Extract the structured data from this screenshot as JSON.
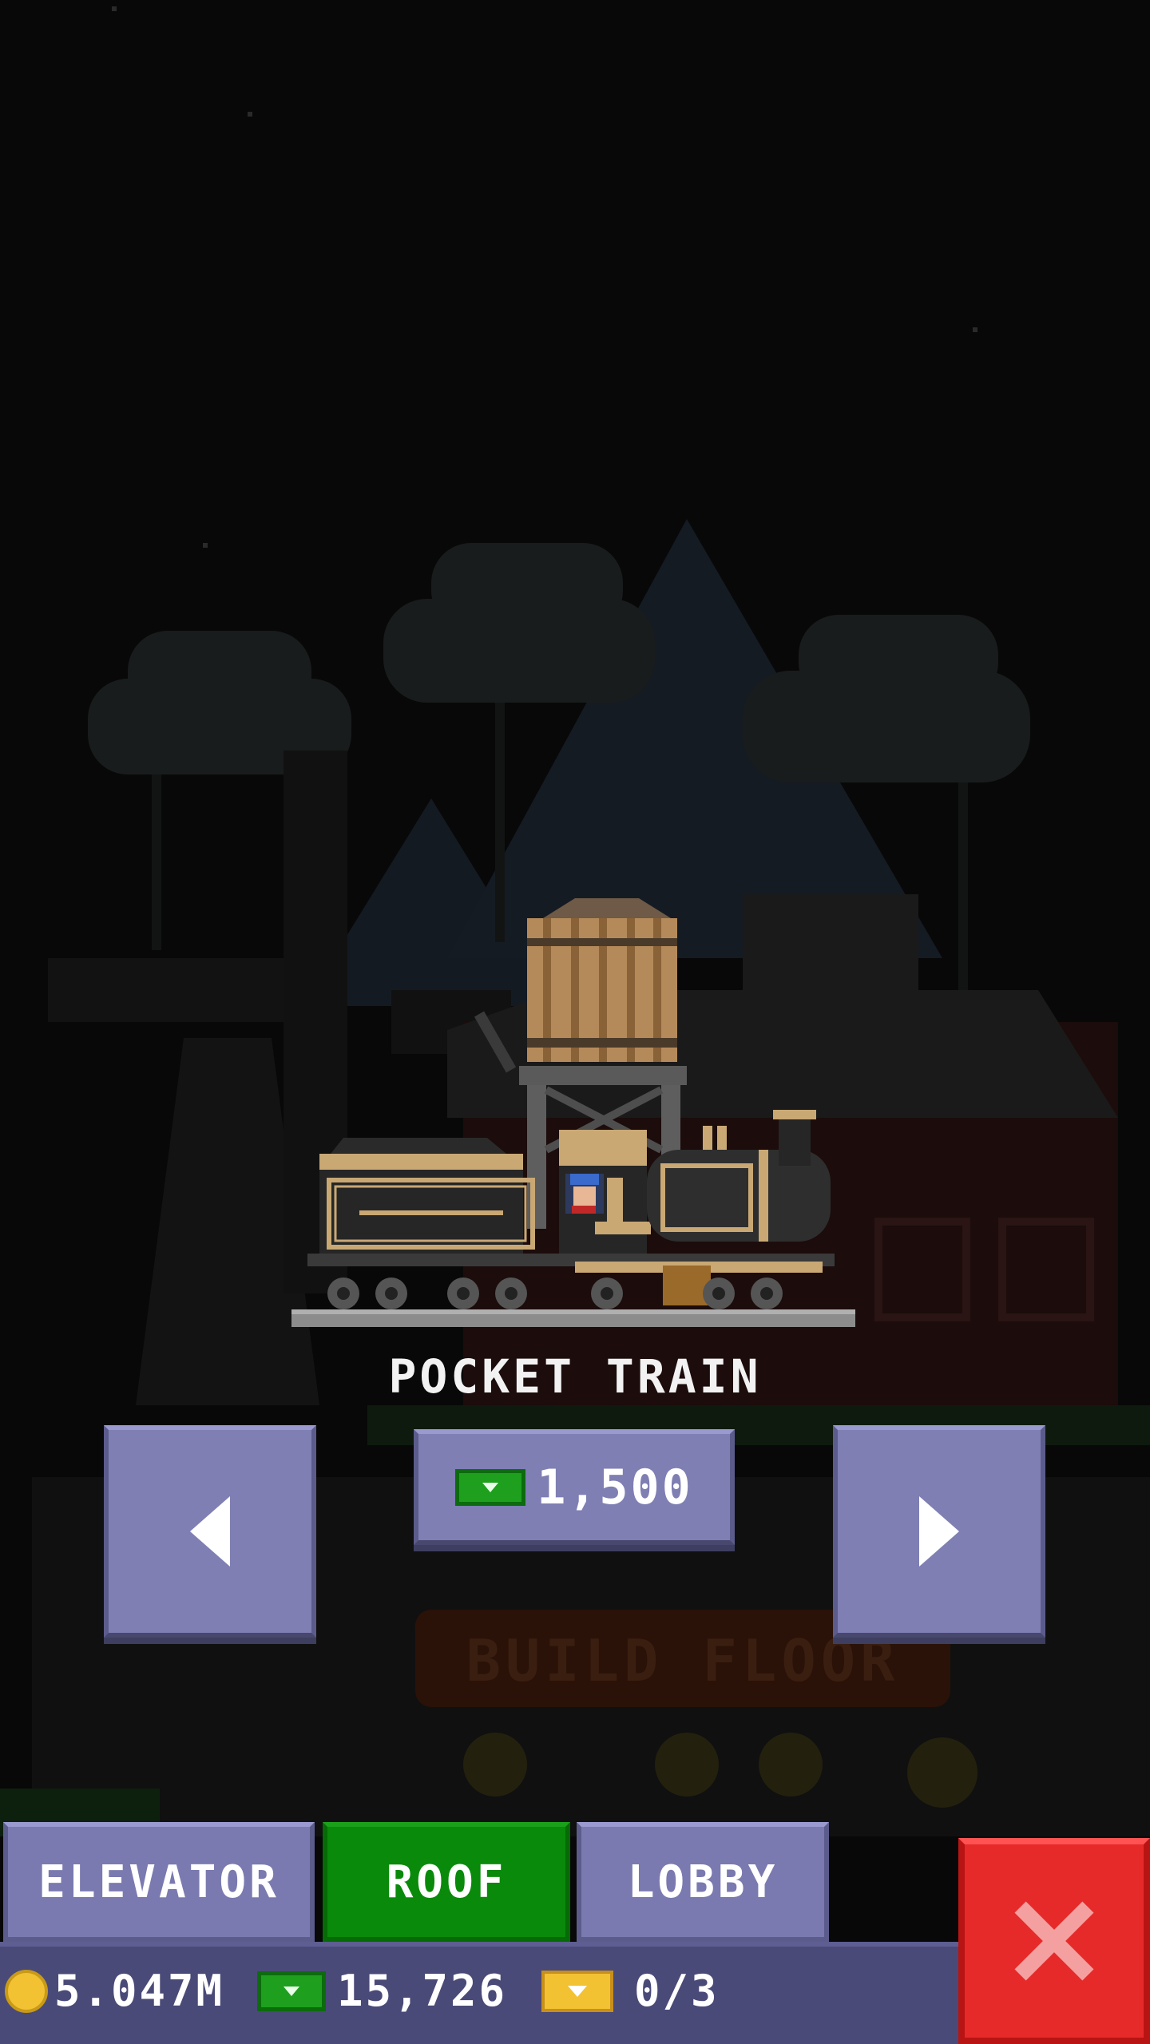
{
  "item": {
    "name": "POCKET TRAIN",
    "price": "1,500"
  },
  "background_sign": "BUILD FLOOR",
  "tabs": {
    "elevator": "ELEVATOR",
    "roof": "ROOF",
    "lobby": "LOBBY",
    "active": "roof"
  },
  "status": {
    "coins": "5.047M",
    "bux": "15,726",
    "tickets": "0/3"
  },
  "icons": {
    "prev": "arrow-left-icon",
    "next": "arrow-right-icon",
    "price": "tower-bux-icon",
    "coins": "coin-icon",
    "bux": "tower-bux-icon",
    "tickets": "ticket-icon",
    "close": "close-x-icon"
  },
  "colors": {
    "button": "#7f7fb4",
    "active_tab": "#0a8a0a",
    "close": "#e62a2a",
    "status_bar": "#4a4a78"
  }
}
